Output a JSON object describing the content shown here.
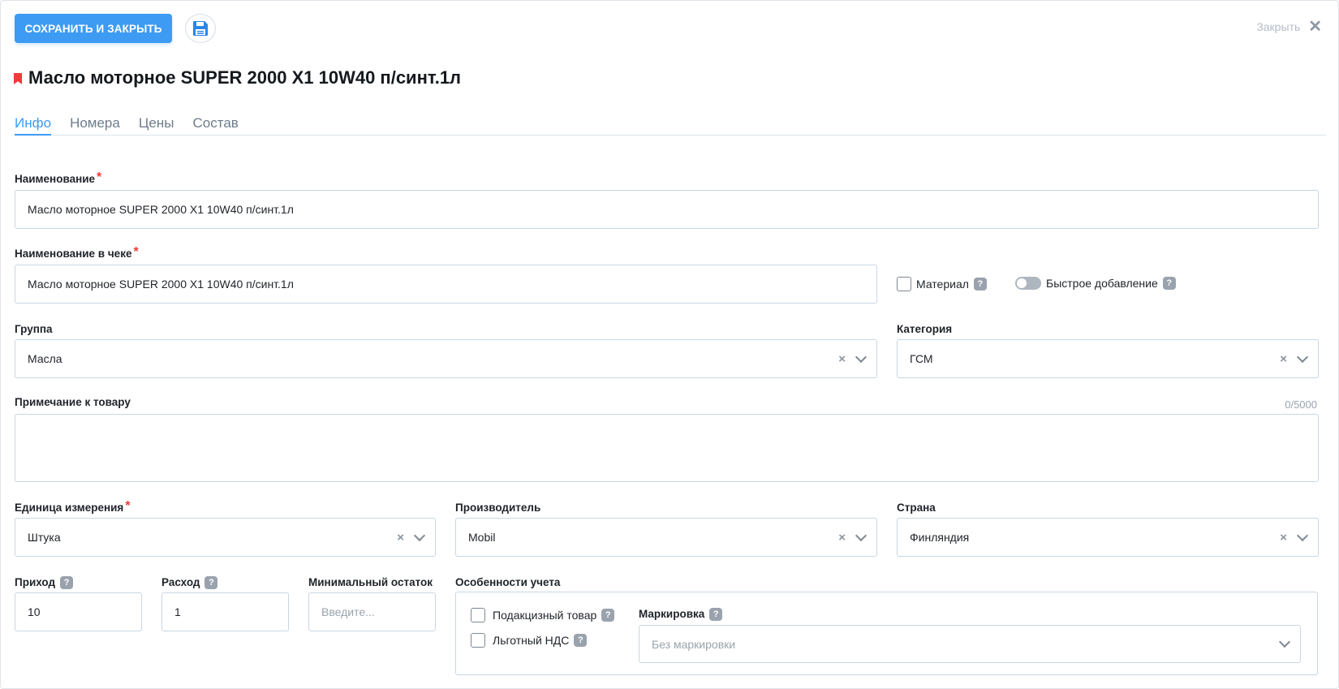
{
  "toolbar": {
    "save_close_label": "СОХРАНИТЬ И ЗАКРЫТЬ",
    "close_label": "Закрыть"
  },
  "header": {
    "title": "Масло моторное SUPER 2000 X1 10W40 п/синт.1л"
  },
  "tabs": [
    {
      "label": "Инфо",
      "active": true
    },
    {
      "label": "Номера"
    },
    {
      "label": "Цены"
    },
    {
      "label": "Состав"
    }
  ],
  "form": {
    "name": {
      "label": "Наименование",
      "value": "Масло моторное SUPER 2000 X1 10W40 п/синт.1л"
    },
    "receipt_name": {
      "label": "Наименование в чеке",
      "value": "Масло моторное SUPER 2000 X1 10W40 п/синт.1л"
    },
    "material": {
      "label": "Материал",
      "checked": false
    },
    "quick_add": {
      "label": "Быстрое добавление",
      "on": false
    },
    "group": {
      "label": "Группа",
      "value": "Масла"
    },
    "category": {
      "label": "Категория",
      "value": "ГСМ"
    },
    "note": {
      "label": "Примечание к товару",
      "value": "",
      "counter": "0/5000"
    },
    "unit": {
      "label": "Единица измерения",
      "value": "Штука"
    },
    "manufacturer": {
      "label": "Производитель",
      "value": "Mobil"
    },
    "country": {
      "label": "Страна",
      "value": "Финляндия"
    },
    "income": {
      "label": "Приход",
      "value": "10"
    },
    "expense": {
      "label": "Расход",
      "value": "1"
    },
    "min_stock": {
      "label": "Минимальный остаток",
      "placeholder": "Введите..."
    },
    "accounting": {
      "label": "Особенности учета",
      "excise": {
        "label": "Подакцизный товар",
        "checked": false
      },
      "vat": {
        "label": "Льготный НДС",
        "checked": false
      },
      "marking": {
        "label": "Маркировка",
        "placeholder": "Без маркировки"
      }
    }
  },
  "colors": {
    "accent": "#3d9bf3",
    "required": "#f03a3a",
    "border": "#c9d6e3"
  },
  "icons": {
    "save": "floppy-disk-icon",
    "close": "close-icon",
    "help": "question-icon",
    "bookmark": "bookmark-icon",
    "clear": "clear-icon",
    "dropdown": "chevron-down-icon"
  }
}
